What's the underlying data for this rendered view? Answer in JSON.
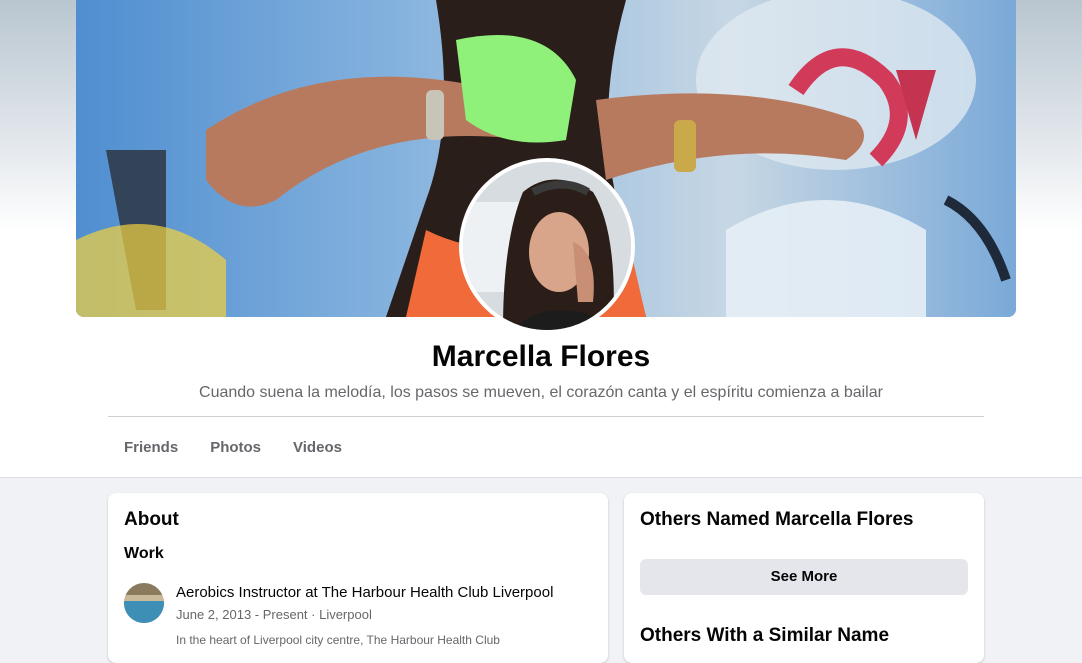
{
  "profile": {
    "name": "Marcella Flores",
    "bio": "Cuando suena la melodía, los pasos se mueven, el corazón canta y el espíritu comienza a bailar"
  },
  "tabs": [
    "Friends",
    "Photos",
    "Videos"
  ],
  "about": {
    "title": "About",
    "work_heading": "Work",
    "job_title": "Aerobics Instructor at The Harbour Health Club Liverpool",
    "job_meta": "June 2, 2013 - Present · Liverpool",
    "job_desc": "In the heart of Liverpool city centre, The Harbour Health Club"
  },
  "others": {
    "title": "Others Named Marcella Flores",
    "see_more": "See More",
    "similar_title": "Others With a Similar Name"
  },
  "colors": {
    "page_bg": "#f0f2f5",
    "card_bg": "#ffffff",
    "secondary_text": "#65676b",
    "button_bg": "#e4e6eb"
  }
}
